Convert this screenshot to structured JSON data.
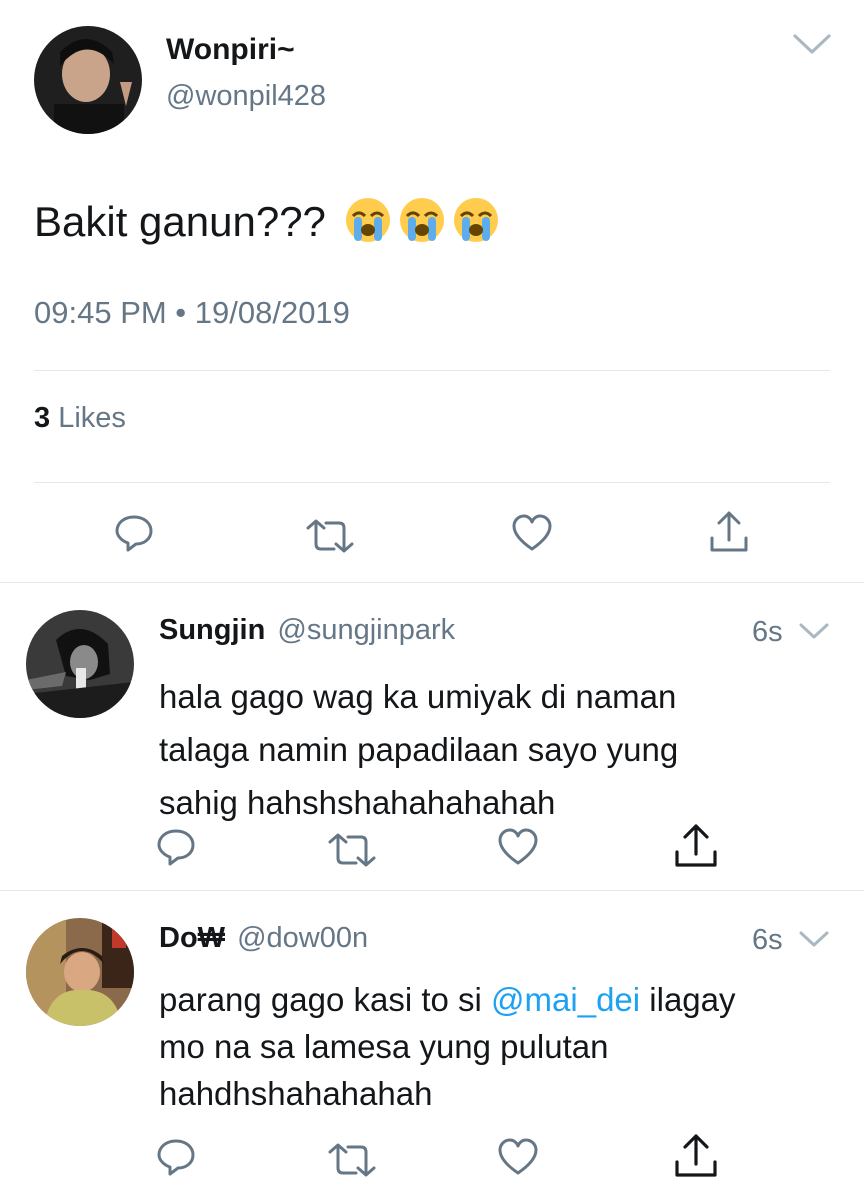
{
  "main_tweet": {
    "display_name": "Wonpiri~",
    "handle": "@wonpil428",
    "text": "Bakit ganun???",
    "emojis": [
      "loudly-crying-face",
      "loudly-crying-face",
      "loudly-crying-face"
    ],
    "timestamp": "09:45 PM • 19/08/2019",
    "likes_count": "3",
    "likes_label": "Likes"
  },
  "replies": [
    {
      "display_name": "Sungjin",
      "handle": "@sungjinpark",
      "time": "6s",
      "lines": [
        "hala gago wag ka umiyak di naman",
        "talaga namin papadilaan sayo yung",
        "sahig hahshshahahahahah"
      ]
    },
    {
      "display_name": "Do₩",
      "handle": "@dow00n",
      "time": "6s",
      "line1_prefix": "parang gago kasi to si ",
      "mention": "@mai_dei",
      "line1_suffix": " ilagay",
      "lines_rest": [
        "mo na sa lamesa yung pulutan",
        "hahdhshahahahah"
      ]
    }
  ],
  "colors": {
    "text": "#14171a",
    "muted": "#657786",
    "divider": "#e1e8ed",
    "link": "#1da1f2",
    "icon": "#657786"
  },
  "icons": [
    "reply-icon",
    "retweet-icon",
    "like-icon",
    "share-icon",
    "chevron-down-icon"
  ]
}
